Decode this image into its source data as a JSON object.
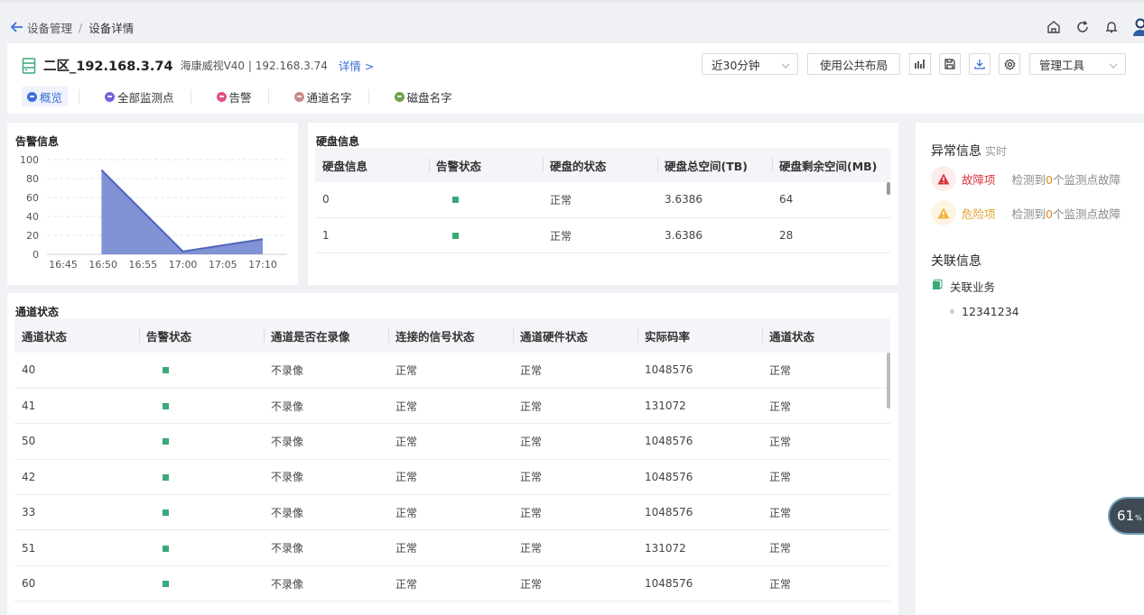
{
  "breadcrumb": {
    "parent": "设备管理",
    "separator": "/",
    "current": "设备详情"
  },
  "device": {
    "name": "二区_192.168.3.74",
    "desc": "海康威视V40 | 192.168.3.74",
    "detail_link": "详情 >"
  },
  "controls": {
    "time_range": "近30分钟",
    "layout_button": "使用公共布局",
    "tools": "管理工具"
  },
  "tabs": [
    {
      "label": "概览",
      "color": "#3b6fd8",
      "active": true
    },
    {
      "label": "全部监测点",
      "color": "#7b61d9",
      "active": false
    },
    {
      "label": "告警",
      "color": "#e0508a",
      "active": false
    },
    {
      "label": "通道名字",
      "color": "#c98a8a",
      "active": false
    },
    {
      "label": "磁盘名字",
      "color": "#6fa14a",
      "active": false
    }
  ],
  "alarm_card": {
    "title": "告警信息"
  },
  "chart_data": {
    "type": "area",
    "title": "告警信息",
    "x": [
      "16:45",
      "16:50",
      "16:55",
      "17:00",
      "17:05",
      "17:10"
    ],
    "series": [
      {
        "points": [
          [
            16.83,
            89
          ],
          [
            17.0,
            3
          ],
          [
            17.167,
            16
          ]
        ]
      }
    ],
    "yticks": [
      0,
      20,
      40,
      60,
      80,
      100
    ],
    "ylim": [
      0,
      100
    ],
    "grid": true,
    "color": "#6f83cf"
  },
  "disk": {
    "title": "硬盘信息",
    "headers": [
      "硬盘信息",
      "告警状态",
      "硬盘的状态",
      "硬盘总空间(TB)",
      "硬盘剩余空间(MB)"
    ],
    "rows": [
      {
        "id": "0",
        "status": "正常",
        "total": "3.6386",
        "free": "64"
      },
      {
        "id": "1",
        "status": "正常",
        "total": "3.6386",
        "free": "28"
      }
    ]
  },
  "channels": {
    "title": "通道状态",
    "headers": [
      "通道状态",
      "告警状态",
      "通道是否在录像",
      "连接的信号状态",
      "通道硬件状态",
      "实际码率",
      "通道状态"
    ],
    "rows": [
      {
        "id": "40",
        "rec": "不录像",
        "signal": "正常",
        "hw": "正常",
        "rate": "1048576",
        "state": "正常"
      },
      {
        "id": "41",
        "rec": "不录像",
        "signal": "正常",
        "hw": "正常",
        "rate": "131072",
        "state": "正常"
      },
      {
        "id": "50",
        "rec": "不录像",
        "signal": "正常",
        "hw": "正常",
        "rate": "1048576",
        "state": "正常"
      },
      {
        "id": "42",
        "rec": "不录像",
        "signal": "正常",
        "hw": "正常",
        "rate": "1048576",
        "state": "正常"
      },
      {
        "id": "33",
        "rec": "不录像",
        "signal": "正常",
        "hw": "正常",
        "rate": "1048576",
        "state": "正常"
      },
      {
        "id": "51",
        "rec": "不录像",
        "signal": "正常",
        "hw": "正常",
        "rate": "131072",
        "state": "正常"
      },
      {
        "id": "60",
        "rec": "不录像",
        "signal": "正常",
        "hw": "正常",
        "rate": "1048576",
        "state": "正常"
      }
    ]
  },
  "abnormal": {
    "title": "异常信息",
    "subtitle": "实时",
    "fault": {
      "label": "故障项",
      "desc_prefix": "检测到",
      "count": "0",
      "desc_suffix": "个监测点故障"
    },
    "danger": {
      "label": "危险项",
      "desc_prefix": "检测到",
      "count": "0",
      "desc_suffix": "个监测点故障"
    }
  },
  "related": {
    "title": "关联信息",
    "item": "关联业务",
    "value": "12341234"
  },
  "badge": {
    "value": "61",
    "unit": "%"
  }
}
